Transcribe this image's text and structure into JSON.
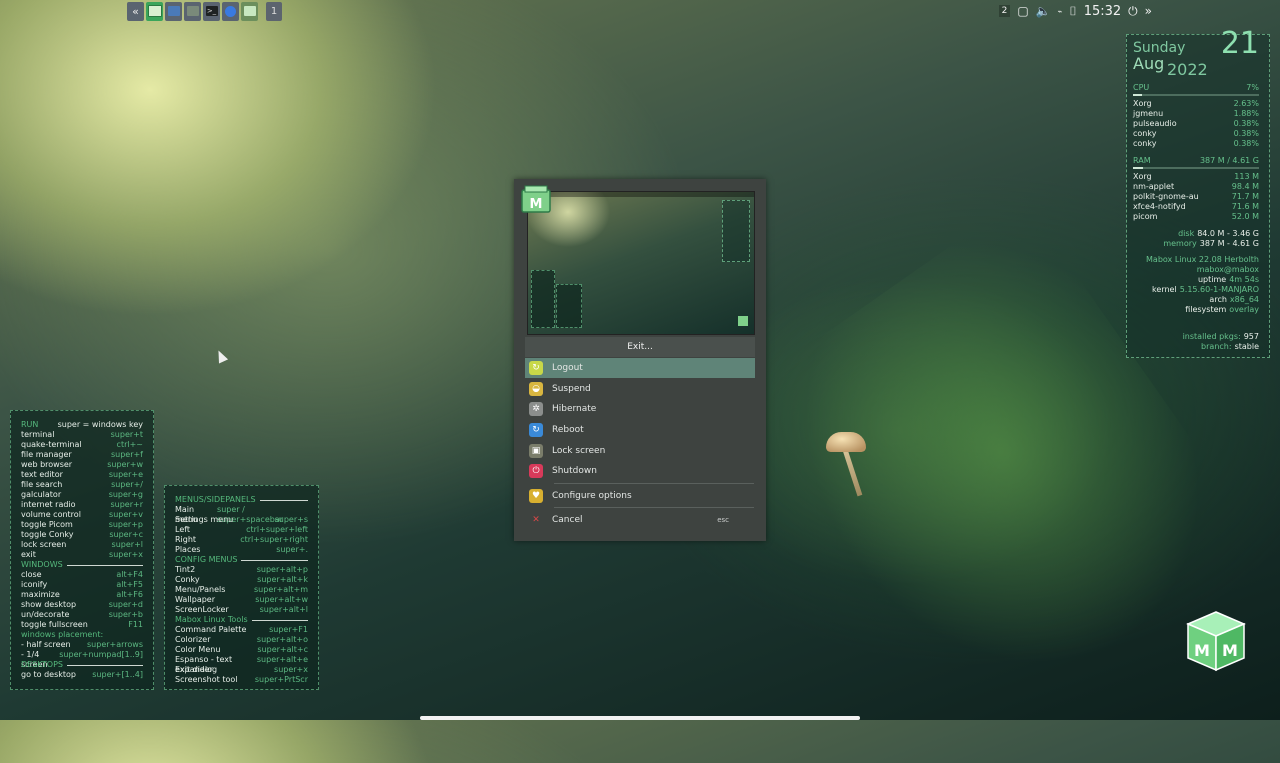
{
  "taskbar": {
    "workspace": "1"
  },
  "tray": {
    "notifications": "2",
    "time": "15:32"
  },
  "conky": {
    "day": "Sunday",
    "month": "Aug",
    "year": "2022",
    "date": "21",
    "cpu_label": "CPU",
    "cpu_value": "7%",
    "cpu_level": 0.07,
    "cpu_procs": [
      {
        "name": "Xorg",
        "value": "2.63%"
      },
      {
        "name": "jgmenu",
        "value": "1.88%"
      },
      {
        "name": "pulseaudio",
        "value": "0.38%"
      },
      {
        "name": "conky",
        "value": "0.38%"
      },
      {
        "name": "conky",
        "value": "0.38%"
      }
    ],
    "ram_label": "RAM",
    "ram_value": "387 M / 4.61 G",
    "ram_level": 0.08,
    "ram_procs": [
      {
        "name": "Xorg",
        "value": "113 M"
      },
      {
        "name": "nm-applet",
        "value": "98.4 M"
      },
      {
        "name": "polkit-gnome-au",
        "value": "71.7 M"
      },
      {
        "name": "xfce4-notifyd",
        "value": "71.6 M"
      },
      {
        "name": "picom",
        "value": "52.0 M"
      }
    ],
    "disk_label": "disk",
    "disk_value": "84.0 M - 3.46 G",
    "memory_label": "memory",
    "memory_value": "387 M - 4.61 G",
    "distro": "Mabox Linux 22.08 Herbolth",
    "user": "mabox@mabox",
    "uptime_label": "uptime",
    "uptime_value": "4m 54s",
    "kernel_label": "kernel",
    "kernel_value": "5.15.60-1-MANJARO",
    "arch_label": "arch",
    "arch_value": "x86_64",
    "fs_label": "filesystem",
    "fs_value": "overlay",
    "pkgs_label": "installed pkgs:",
    "pkgs_value": "957",
    "branch_label": "branch:",
    "branch_value": "stable"
  },
  "help_left": {
    "run_label": "RUN",
    "super_note": "super = windows key",
    "run_items": [
      {
        "k": "terminal",
        "v": "super+t"
      },
      {
        "k": "quake-terminal",
        "v": "ctrl+~"
      },
      {
        "k": "file manager",
        "v": "super+f"
      },
      {
        "k": "web browser",
        "v": "super+w"
      },
      {
        "k": "text editor",
        "v": "super+e"
      },
      {
        "k": "file search",
        "v": "super+/"
      },
      {
        "k": "galculator",
        "v": "super+g"
      },
      {
        "k": "internet radio",
        "v": "super+r"
      },
      {
        "k": "volume control",
        "v": "super+v"
      },
      {
        "k": "toggle Picom",
        "v": "super+p"
      },
      {
        "k": "toggle Conky",
        "v": "super+c"
      },
      {
        "k": "lock screen",
        "v": "super+l"
      },
      {
        "k": "exit",
        "v": "super+x"
      }
    ],
    "windows_label": "WINDOWS",
    "windows_items": [
      {
        "k": "close",
        "v": "alt+F4"
      },
      {
        "k": "iconify",
        "v": "alt+F5"
      },
      {
        "k": "maximize",
        "v": "alt+F6"
      },
      {
        "k": "show desktop",
        "v": "super+d"
      },
      {
        "k": "un/decorate",
        "v": "super+b"
      },
      {
        "k": "toggle fullscreen",
        "v": "F11"
      }
    ],
    "placement_label": "windows placement:",
    "placement_items": [
      {
        "k": "- half screen",
        "v": "super+arrows"
      },
      {
        "k": "- 1/4 screen",
        "v": "super+numpad[1..9]"
      }
    ],
    "desktops_label": "DESKTOPS",
    "desktops_items": [
      {
        "k": "go to desktop",
        "v": "super+[1..4]"
      }
    ]
  },
  "help_right": {
    "menus_label": "MENUS/SIDEPANELS",
    "menus_items": [
      {
        "k": "Main menu",
        "v": "super / super+spacebar"
      },
      {
        "k": "Settings menu",
        "v": "super+s"
      },
      {
        "k": "Left",
        "v": "ctrl+super+left"
      },
      {
        "k": "Right",
        "v": "ctrl+super+right"
      },
      {
        "k": "Places",
        "v": "super+."
      }
    ],
    "config_label": "CONFIG MENUS",
    "config_items": [
      {
        "k": "Tint2",
        "v": "super+alt+p"
      },
      {
        "k": "Conky",
        "v": "super+alt+k"
      },
      {
        "k": "Menu/Panels",
        "v": "super+alt+m"
      },
      {
        "k": "Wallpaper",
        "v": "super+alt+w"
      },
      {
        "k": "ScreenLocker",
        "v": "super+alt+l"
      }
    ],
    "tools_label": "Mabox Linux Tools",
    "tools_items": [
      {
        "k": "Command Palette",
        "v": "super+F1"
      },
      {
        "k": "Colorizer",
        "v": "super+alt+o"
      },
      {
        "k": "Color Menu",
        "v": "super+alt+c"
      },
      {
        "k": "Espanso - text expander",
        "v": "super+alt+e"
      },
      {
        "k": "Exit dialog",
        "v": "super+x"
      },
      {
        "k": "Screenshot tool",
        "v": "super+PrtScr"
      }
    ]
  },
  "dialog": {
    "title": "Exit...",
    "items": [
      {
        "label": "Logout",
        "icon": "logout-icon",
        "color": "#c8d848"
      },
      {
        "label": "Suspend",
        "icon": "suspend-icon",
        "color": "#d8b640"
      },
      {
        "label": "Hibernate",
        "icon": "hibernate-icon",
        "color": "#8b8e8c"
      },
      {
        "label": "Reboot",
        "icon": "reboot-icon",
        "color": "#3a8ad8"
      },
      {
        "label": "Lock screen",
        "icon": "lock-icon",
        "color": "#7a7d6a"
      },
      {
        "label": "Shutdown",
        "icon": "shutdown-icon",
        "color": "#d83a5a"
      },
      {
        "label": "Configure options",
        "icon": "configure-icon",
        "color": "#d8b030"
      },
      {
        "label": "Cancel",
        "icon": "cancel-icon",
        "color": "#d84848"
      }
    ],
    "cancel_shortcut": "esc",
    "selected_color": "#5f8478"
  },
  "colors": {
    "accent": "#5cb882",
    "panel_border": "#4f8f6a"
  }
}
